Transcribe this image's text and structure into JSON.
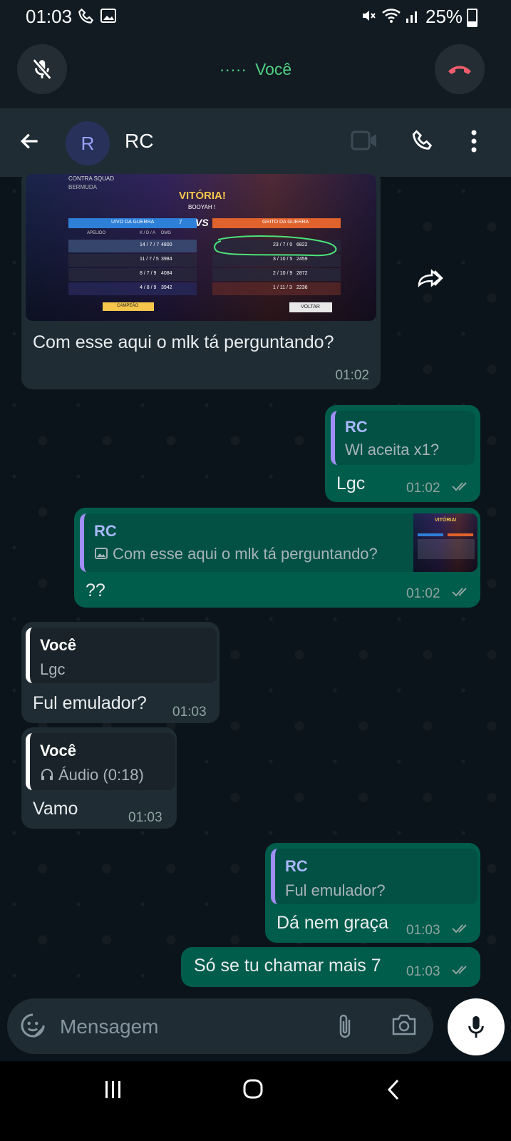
{
  "status_bar": {
    "time": "01:03",
    "battery": "25%"
  },
  "call_bar": {
    "dots": "·····",
    "label": "Você"
  },
  "header": {
    "avatar_letter": "R",
    "contact_name": "RC"
  },
  "messages": {
    "m1": {
      "caption": "Com esse aqui o mlk tá perguntando?",
      "time": "01:02",
      "image": {
        "title": "VITÓRIA!",
        "subtitle": "BOOYAH !",
        "mode": "CONTRA SQUAD",
        "map": "BERMUDA",
        "vs": "VS",
        "team_left": "UIVO DA GUERRA",
        "team_left_score": "7",
        "team_right": "GRITO DA GUERRA",
        "button": "VOLTAR",
        "mvp": "CAMPEÃO",
        "col_apelido": "APELIDO",
        "col_kda": "K / D / A",
        "col_dmg": "DMG",
        "rows_left": [
          {
            "kda": "14 / 7 / 7",
            "dmg": "4800"
          },
          {
            "kda": "11 / 7 / 5",
            "dmg": "3984"
          },
          {
            "kda": "8 / 7 / 9",
            "dmg": "4084"
          },
          {
            "kda": "4 / 8 / 9",
            "dmg": "3942"
          }
        ],
        "rows_right": [
          {
            "kda": "23 / 7 / 0",
            "dmg": "6822"
          },
          {
            "kda": "3 / 10 / 5",
            "dmg": "2459"
          },
          {
            "kda": "2 / 10 / 9",
            "dmg": "2872"
          },
          {
            "kda": "1 / 11 / 3",
            "dmg": "2236"
          }
        ]
      }
    },
    "m2": {
      "quote_name": "RC",
      "quote_text": "Wl aceita x1?",
      "text": "Lgc",
      "time": "01:02"
    },
    "m3": {
      "quote_name": "RC",
      "quote_text": "Com esse aqui o mlk tá perguntando?",
      "text": "??",
      "time": "01:02",
      "thumb_title": "VITÓRIA!"
    },
    "m4": {
      "quote_name": "Você",
      "quote_text": "Lgc",
      "text": "Ful emulador?",
      "time": "01:03"
    },
    "m5": {
      "quote_name": "Você",
      "quote_text": "Áudio (0:18)",
      "text": "Vamo",
      "time": "01:03"
    },
    "m6": {
      "quote_name": "RC",
      "quote_text": "Ful emulador?",
      "text": "Dá nem graça",
      "time": "01:03"
    },
    "m7": {
      "text": "Só se tu chamar mais 7",
      "time": "01:03"
    }
  },
  "input": {
    "placeholder": "Mensagem"
  },
  "colors": {
    "accent_green": "#4fd184",
    "outgoing_bubble": "#005c4b",
    "incoming_bubble": "#1f2c34",
    "end_call": "#f15c6d"
  }
}
